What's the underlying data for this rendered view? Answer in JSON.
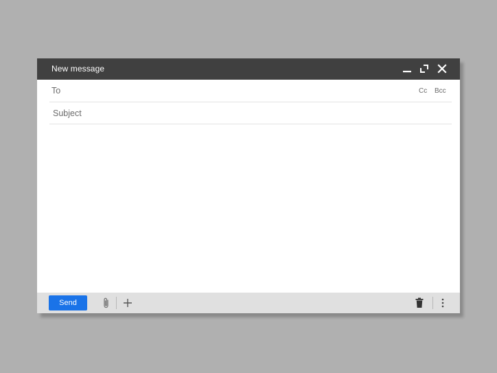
{
  "window": {
    "title": "New message"
  },
  "fields": {
    "to_label": "To",
    "to_value": "",
    "cc_label": "Cc",
    "bcc_label": "Bcc",
    "subject_placeholder": "Subject",
    "subject_value": "",
    "body_value": ""
  },
  "toolbar": {
    "send_label": "Send"
  },
  "icons": {
    "minimize": "minimize-icon",
    "popout": "popout-icon",
    "close": "close-icon",
    "attach": "paperclip-icon",
    "insert": "plus-icon",
    "delete": "trash-icon",
    "more": "more-vert-icon"
  },
  "colors": {
    "background": "#b0b0b0",
    "titlebar": "#404040",
    "send_button": "#1a73e8",
    "bottombar": "#e0e0e0"
  }
}
